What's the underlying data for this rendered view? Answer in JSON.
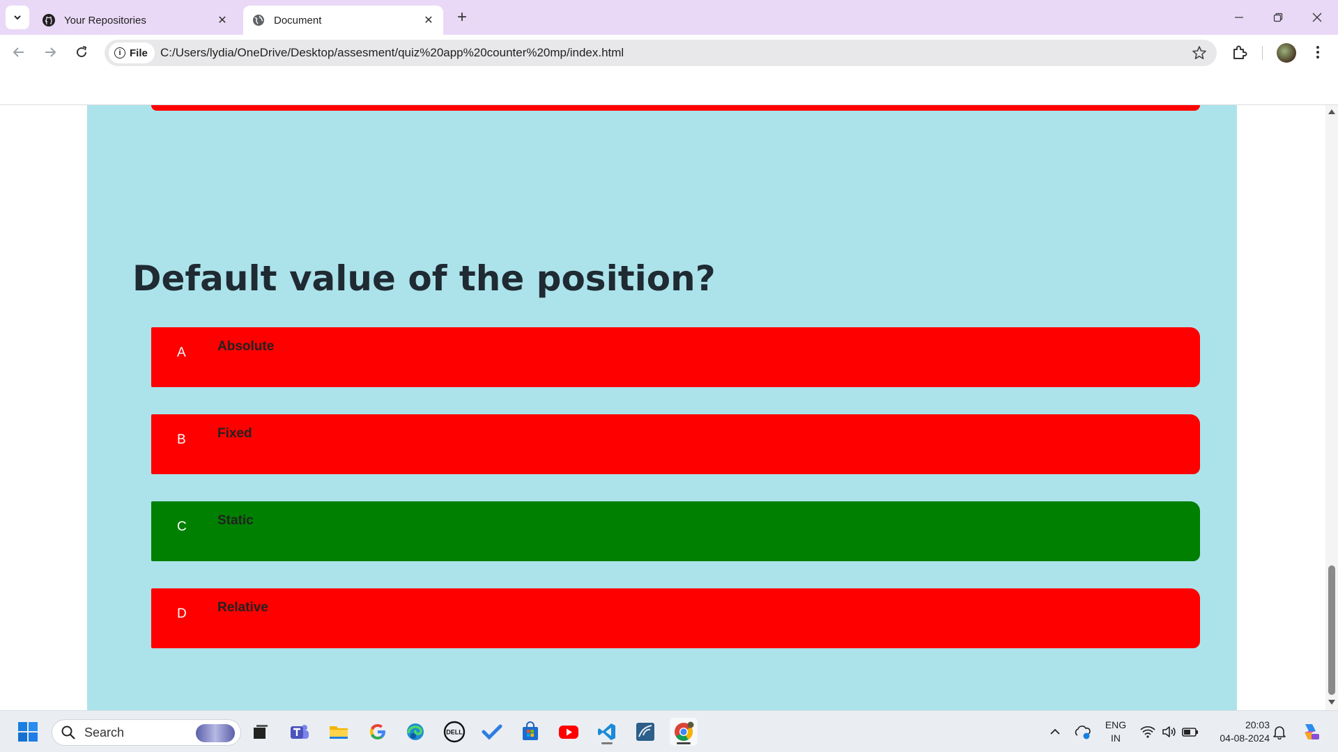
{
  "browser": {
    "tabs": [
      {
        "title": "Your Repositories",
        "icon": "github-icon",
        "active": false
      },
      {
        "title": "Document",
        "icon": "globe-icon",
        "active": true
      }
    ],
    "close_symbol": "✕",
    "new_tab_symbol": "+",
    "address": {
      "chip_label": "File",
      "info_symbol": "i",
      "url": "C:/Users/lydia/OneDrive/Desktop/assesment/quiz%20app%20counter%20mp/index.html"
    }
  },
  "quiz": {
    "question": "Default value of the position?",
    "options": [
      {
        "letter": "A",
        "text": "Absolute",
        "state": "incorrect",
        "color": "#ff0000"
      },
      {
        "letter": "B",
        "text": "Fixed",
        "state": "incorrect",
        "color": "#ff0000"
      },
      {
        "letter": "C",
        "text": "Static",
        "state": "correct",
        "color": "#008000"
      },
      {
        "letter": "D",
        "text": "Relative",
        "state": "incorrect",
        "color": "#ff0000"
      }
    ],
    "panel_color": "#ace3ea"
  },
  "taskbar": {
    "search_label": "Search",
    "apps": [
      "windows-start-icon",
      "task-view-icon",
      "teams-icon",
      "file-explorer-icon",
      "google-icon",
      "edge-icon",
      "dell-icon",
      "todo-icon",
      "store-icon",
      "youtube-icon",
      "vscode-icon",
      "mysql-workbench-icon",
      "chrome-icon"
    ],
    "language": {
      "line1": "ENG",
      "line2": "IN"
    },
    "clock": {
      "time": "20:03",
      "date": "04-08-2024"
    }
  }
}
